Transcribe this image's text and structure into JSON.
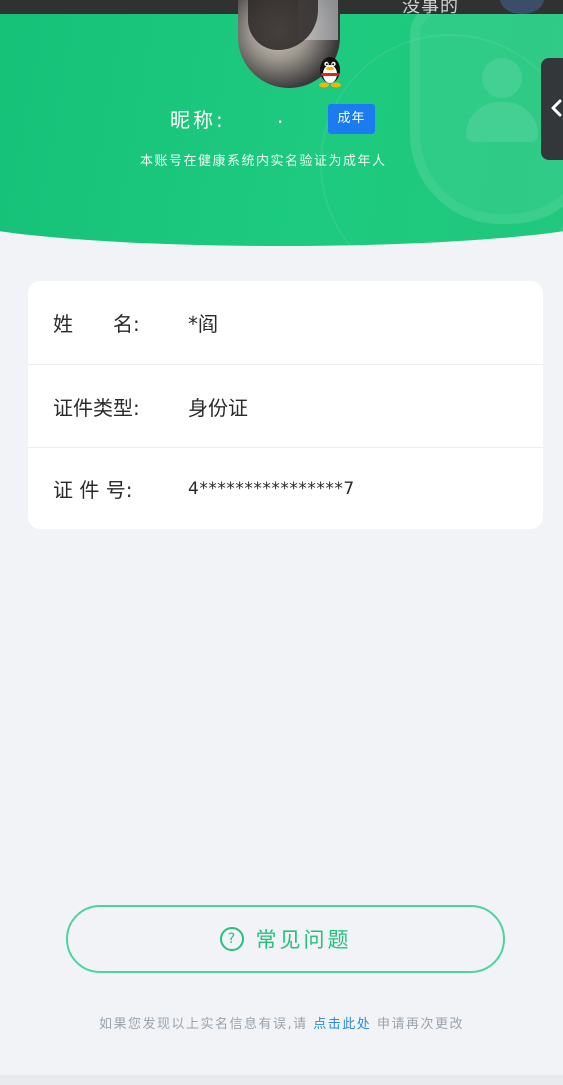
{
  "status_bar": {
    "partial_text": "没事的"
  },
  "header": {
    "nickname_label": "昵称:",
    "nickname_value": ".",
    "badge": "成年",
    "verify_note": "本账号在健康系统内实名验证为成年人"
  },
  "info": {
    "rows": [
      {
        "label": "姓　　名:",
        "value": "*阎"
      },
      {
        "label": "证件类型:",
        "value": "身份证"
      },
      {
        "label": "证 件 号:",
        "value": "4****************7"
      }
    ]
  },
  "faq": {
    "icon": "question-circle-icon",
    "label": "常见问题"
  },
  "footer": {
    "prefix": "如果您发现以上实名信息有误,请",
    "link": "点击此处",
    "suffix": "申请再次更改"
  },
  "colors": {
    "header_green": "#1dca7f",
    "badge_blue": "#1a7cf0",
    "faq_green": "#27c07d",
    "link_blue": "#2b8ae8"
  }
}
